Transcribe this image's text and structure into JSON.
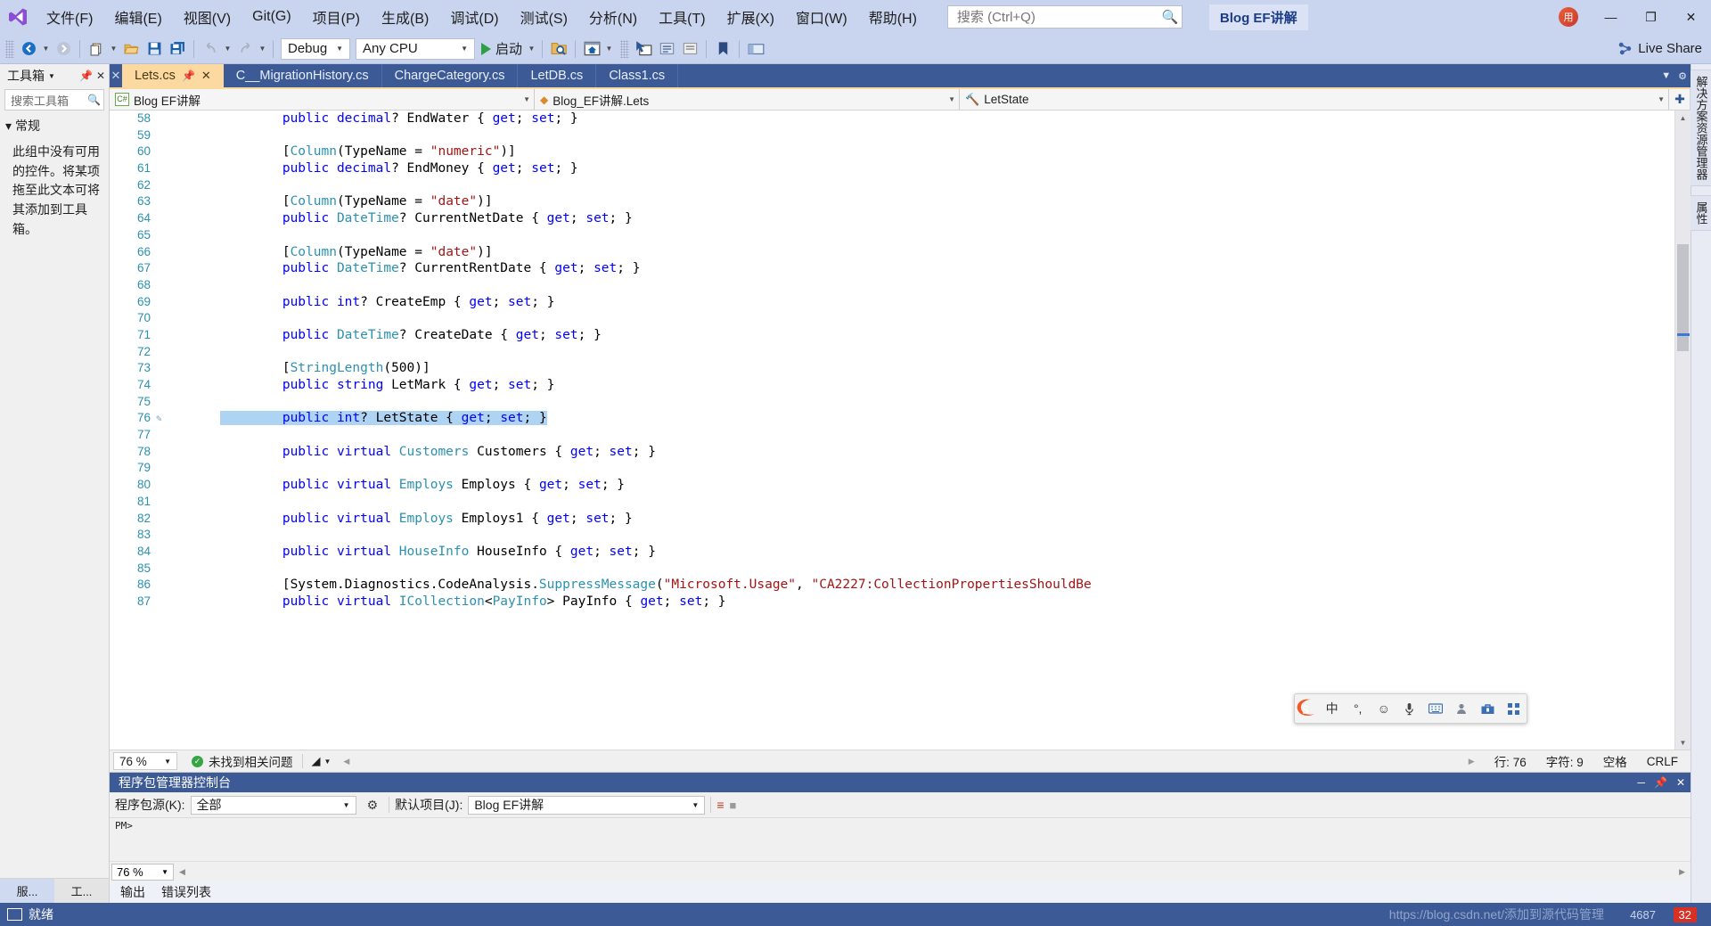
{
  "titlebar": {
    "logo_icon": "visual-studio-logo",
    "menus": [
      {
        "label": "文件(F)"
      },
      {
        "label": "编辑(E)"
      },
      {
        "label": "视图(V)"
      },
      {
        "label": "Git(G)"
      },
      {
        "label": "项目(P)"
      },
      {
        "label": "生成(B)"
      },
      {
        "label": "调试(D)"
      },
      {
        "label": "测试(S)"
      },
      {
        "label": "分析(N)"
      },
      {
        "label": "工具(T)"
      },
      {
        "label": "扩展(X)"
      },
      {
        "label": "窗口(W)"
      },
      {
        "label": "帮助(H)"
      }
    ],
    "search_placeholder": "搜索 (Ctrl+Q)",
    "search_value": "",
    "search_icon": "magnifier-icon",
    "solution_name": "Blog EF讲解",
    "avatar_initials": "用",
    "window_buttons": {
      "minimize": "—",
      "maximize": "❐",
      "close": "✕"
    }
  },
  "toolbar": {
    "nav_back_icon": "back-arrow-icon",
    "nav_forward_icon": "forward-arrow-icon",
    "new_item_icon": "new-file-icon",
    "open_icon": "open-folder-icon",
    "save_icon": "save-icon",
    "save_all_icon": "save-all-icon",
    "undo_icon": "undo-icon",
    "redo_icon": "redo-icon",
    "config_value": "Debug",
    "platform_value": "Any CPU",
    "run_label": "启动",
    "run_icon": "play-icon",
    "find_in_files_icon": "folder-search-icon",
    "home_icon": "home-window-icon",
    "select_icon": "pointer-window-icon",
    "bookmark_icon": "bookmark-icon",
    "comment_icon": "comment-icon",
    "uncomment_icon": "uncomment-icon",
    "live_share_label": "Live Share",
    "live_share_icon": "live-share-icon"
  },
  "toolbox": {
    "title": "工具箱",
    "pin_icon": "pin-icon",
    "close_icon": "close-icon",
    "search_placeholder": "搜索工具箱",
    "search_icon": "magnifier-icon",
    "group_label": "常规",
    "group_expand_icon": "triangle-down-icon",
    "empty_message": "此组中没有可用的控件。将某项拖至此文本可将其添加到工具箱。",
    "bottom_tabs": [
      {
        "label": "服...",
        "active": true
      },
      {
        "label": "工...",
        "active": false
      }
    ]
  },
  "tabstrip": {
    "left_close_icon": "close-icon",
    "tabs": [
      {
        "label": "Lets.cs",
        "active": true,
        "pin_icon": "pin-icon",
        "close_icon": "close-icon"
      },
      {
        "label": "C__MigrationHistory.cs",
        "active": false
      },
      {
        "label": "ChargeCategory.cs",
        "active": false
      },
      {
        "label": "LetDB.cs",
        "active": false
      },
      {
        "label": "Class1.cs",
        "active": false
      }
    ],
    "right_icons": [
      "chevron-down-icon",
      "gear-icon"
    ]
  },
  "navbar": {
    "project": {
      "label": "Blog EF讲解",
      "icon": "csharp-project-icon"
    },
    "type": {
      "label": "Blog_EF讲解.Lets",
      "icon": "namespace-icon"
    },
    "member": {
      "label": "LetState",
      "icon": "property-icon"
    },
    "expand_icon": "expand-icon"
  },
  "editor": {
    "first_line": 58,
    "selected_line": 76,
    "lines": [
      {
        "n": 58,
        "tokens": [
          {
            "t": "        ",
            "c": "plain"
          },
          {
            "t": "public ",
            "c": "kw"
          },
          {
            "t": "decimal",
            "c": "kw"
          },
          {
            "t": "? EndWater { ",
            "c": "plain"
          },
          {
            "t": "get",
            "c": "kw"
          },
          {
            "t": "; ",
            "c": "plain"
          },
          {
            "t": "set",
            "c": "kw"
          },
          {
            "t": "; }",
            "c": "plain"
          }
        ]
      },
      {
        "n": 59,
        "tokens": []
      },
      {
        "n": 60,
        "tokens": [
          {
            "t": "        [",
            "c": "plain"
          },
          {
            "t": "Column",
            "c": "typ"
          },
          {
            "t": "(TypeName = ",
            "c": "plain"
          },
          {
            "t": "\"numeric\"",
            "c": "str"
          },
          {
            "t": ")]",
            "c": "plain"
          }
        ]
      },
      {
        "n": 61,
        "tokens": [
          {
            "t": "        ",
            "c": "plain"
          },
          {
            "t": "public ",
            "c": "kw"
          },
          {
            "t": "decimal",
            "c": "kw"
          },
          {
            "t": "? EndMoney { ",
            "c": "plain"
          },
          {
            "t": "get",
            "c": "kw"
          },
          {
            "t": "; ",
            "c": "plain"
          },
          {
            "t": "set",
            "c": "kw"
          },
          {
            "t": "; }",
            "c": "plain"
          }
        ]
      },
      {
        "n": 62,
        "tokens": []
      },
      {
        "n": 63,
        "tokens": [
          {
            "t": "        [",
            "c": "plain"
          },
          {
            "t": "Column",
            "c": "typ"
          },
          {
            "t": "(TypeName = ",
            "c": "plain"
          },
          {
            "t": "\"date\"",
            "c": "str"
          },
          {
            "t": ")]",
            "c": "plain"
          }
        ]
      },
      {
        "n": 64,
        "tokens": [
          {
            "t": "        ",
            "c": "plain"
          },
          {
            "t": "public ",
            "c": "kw"
          },
          {
            "t": "DateTime",
            "c": "typ"
          },
          {
            "t": "? CurrentNetDate { ",
            "c": "plain"
          },
          {
            "t": "get",
            "c": "kw"
          },
          {
            "t": "; ",
            "c": "plain"
          },
          {
            "t": "set",
            "c": "kw"
          },
          {
            "t": "; }",
            "c": "plain"
          }
        ]
      },
      {
        "n": 65,
        "tokens": []
      },
      {
        "n": 66,
        "tokens": [
          {
            "t": "        [",
            "c": "plain"
          },
          {
            "t": "Column",
            "c": "typ"
          },
          {
            "t": "(TypeName = ",
            "c": "plain"
          },
          {
            "t": "\"date\"",
            "c": "str"
          },
          {
            "t": ")]",
            "c": "plain"
          }
        ]
      },
      {
        "n": 67,
        "tokens": [
          {
            "t": "        ",
            "c": "plain"
          },
          {
            "t": "public ",
            "c": "kw"
          },
          {
            "t": "DateTime",
            "c": "typ"
          },
          {
            "t": "? CurrentRentDate { ",
            "c": "plain"
          },
          {
            "t": "get",
            "c": "kw"
          },
          {
            "t": "; ",
            "c": "plain"
          },
          {
            "t": "set",
            "c": "kw"
          },
          {
            "t": "; }",
            "c": "plain"
          }
        ]
      },
      {
        "n": 68,
        "tokens": []
      },
      {
        "n": 69,
        "tokens": [
          {
            "t": "        ",
            "c": "plain"
          },
          {
            "t": "public ",
            "c": "kw"
          },
          {
            "t": "int",
            "c": "kw"
          },
          {
            "t": "? CreateEmp { ",
            "c": "plain"
          },
          {
            "t": "get",
            "c": "kw"
          },
          {
            "t": "; ",
            "c": "plain"
          },
          {
            "t": "set",
            "c": "kw"
          },
          {
            "t": "; }",
            "c": "plain"
          }
        ]
      },
      {
        "n": 70,
        "tokens": []
      },
      {
        "n": 71,
        "tokens": [
          {
            "t": "        ",
            "c": "plain"
          },
          {
            "t": "public ",
            "c": "kw"
          },
          {
            "t": "DateTime",
            "c": "typ"
          },
          {
            "t": "? CreateDate { ",
            "c": "plain"
          },
          {
            "t": "get",
            "c": "kw"
          },
          {
            "t": "; ",
            "c": "plain"
          },
          {
            "t": "set",
            "c": "kw"
          },
          {
            "t": "; }",
            "c": "plain"
          }
        ]
      },
      {
        "n": 72,
        "tokens": []
      },
      {
        "n": 73,
        "tokens": [
          {
            "t": "        [",
            "c": "plain"
          },
          {
            "t": "StringLength",
            "c": "typ"
          },
          {
            "t": "(500)]",
            "c": "plain"
          }
        ]
      },
      {
        "n": 74,
        "tokens": [
          {
            "t": "        ",
            "c": "plain"
          },
          {
            "t": "public ",
            "c": "kw"
          },
          {
            "t": "string",
            "c": "kw"
          },
          {
            "t": " LetMark { ",
            "c": "plain"
          },
          {
            "t": "get",
            "c": "kw"
          },
          {
            "t": "; ",
            "c": "plain"
          },
          {
            "t": "set",
            "c": "kw"
          },
          {
            "t": "; }",
            "c": "plain"
          }
        ]
      },
      {
        "n": 75,
        "tokens": []
      },
      {
        "n": 76,
        "selected": true,
        "glyph": "pencil-icon",
        "tokens": [
          {
            "t": "        ",
            "c": "plain"
          },
          {
            "t": "public ",
            "c": "kw"
          },
          {
            "t": "int",
            "c": "kw"
          },
          {
            "t": "? LetState { ",
            "c": "plain"
          },
          {
            "t": "get",
            "c": "kw"
          },
          {
            "t": "; ",
            "c": "plain"
          },
          {
            "t": "set",
            "c": "kw"
          },
          {
            "t": "; }",
            "c": "plain"
          }
        ]
      },
      {
        "n": 77,
        "tokens": []
      },
      {
        "n": 78,
        "tokens": [
          {
            "t": "        ",
            "c": "plain"
          },
          {
            "t": "public ",
            "c": "kw"
          },
          {
            "t": "virtual ",
            "c": "kw"
          },
          {
            "t": "Customers",
            "c": "typ"
          },
          {
            "t": " Customers { ",
            "c": "plain"
          },
          {
            "t": "get",
            "c": "kw"
          },
          {
            "t": "; ",
            "c": "plain"
          },
          {
            "t": "set",
            "c": "kw"
          },
          {
            "t": "; }",
            "c": "plain"
          }
        ]
      },
      {
        "n": 79,
        "tokens": []
      },
      {
        "n": 80,
        "tokens": [
          {
            "t": "        ",
            "c": "plain"
          },
          {
            "t": "public ",
            "c": "kw"
          },
          {
            "t": "virtual ",
            "c": "kw"
          },
          {
            "t": "Employs",
            "c": "typ"
          },
          {
            "t": " Employs { ",
            "c": "plain"
          },
          {
            "t": "get",
            "c": "kw"
          },
          {
            "t": "; ",
            "c": "plain"
          },
          {
            "t": "set",
            "c": "kw"
          },
          {
            "t": "; }",
            "c": "plain"
          }
        ]
      },
      {
        "n": 81,
        "tokens": []
      },
      {
        "n": 82,
        "tokens": [
          {
            "t": "        ",
            "c": "plain"
          },
          {
            "t": "public ",
            "c": "kw"
          },
          {
            "t": "virtual ",
            "c": "kw"
          },
          {
            "t": "Employs",
            "c": "typ"
          },
          {
            "t": " Employs1 { ",
            "c": "plain"
          },
          {
            "t": "get",
            "c": "kw"
          },
          {
            "t": "; ",
            "c": "plain"
          },
          {
            "t": "set",
            "c": "kw"
          },
          {
            "t": "; }",
            "c": "plain"
          }
        ]
      },
      {
        "n": 83,
        "tokens": []
      },
      {
        "n": 84,
        "tokens": [
          {
            "t": "        ",
            "c": "plain"
          },
          {
            "t": "public ",
            "c": "kw"
          },
          {
            "t": "virtual ",
            "c": "kw"
          },
          {
            "t": "HouseInfo",
            "c": "typ"
          },
          {
            "t": " HouseInfo { ",
            "c": "plain"
          },
          {
            "t": "get",
            "c": "kw"
          },
          {
            "t": "; ",
            "c": "plain"
          },
          {
            "t": "set",
            "c": "kw"
          },
          {
            "t": "; }",
            "c": "plain"
          }
        ]
      },
      {
        "n": 85,
        "tokens": []
      },
      {
        "n": 86,
        "tokens": [
          {
            "t": "        [System.Diagnostics.CodeAnalysis.",
            "c": "plain"
          },
          {
            "t": "SuppressMessage",
            "c": "typ"
          },
          {
            "t": "(",
            "c": "plain"
          },
          {
            "t": "\"Microsoft.Usage\"",
            "c": "str"
          },
          {
            "t": ", ",
            "c": "plain"
          },
          {
            "t": "\"CA2227:CollectionPropertiesShouldBe",
            "c": "str"
          }
        ]
      },
      {
        "n": 87,
        "tokens": [
          {
            "t": "        ",
            "c": "plain"
          },
          {
            "t": "public ",
            "c": "kw"
          },
          {
            "t": "virtual ",
            "c": "kw"
          },
          {
            "t": "ICollection",
            "c": "typ"
          },
          {
            "t": "<",
            "c": "plain"
          },
          {
            "t": "PayInfo",
            "c": "typ"
          },
          {
            "t": "> PayInfo { ",
            "c": "plain"
          },
          {
            "t": "get",
            "c": "kw"
          },
          {
            "t": "; ",
            "c": "plain"
          },
          {
            "t": "set",
            "c": "kw"
          },
          {
            "t": "; }",
            "c": "plain"
          }
        ]
      }
    ]
  },
  "right_dock": {
    "tabs": [
      {
        "label": "解决方案资源管理器"
      },
      {
        "label": "属性"
      }
    ]
  },
  "ime": {
    "logo_icon": "sogou-logo-icon",
    "items": [
      {
        "icon": "chinese-mode-icon",
        "label": "中"
      },
      {
        "icon": "punctuation-icon",
        "label": "°,"
      },
      {
        "icon": "emoji-icon",
        "label": "☺"
      },
      {
        "icon": "microphone-icon",
        "label": "🎤"
      },
      {
        "icon": "keyboard-icon",
        "label": "⌨"
      },
      {
        "icon": "person-icon",
        "label": "👤"
      },
      {
        "icon": "toolbox-icon",
        "label": "🧰"
      },
      {
        "icon": "grid-menu-icon",
        "label": "▦"
      }
    ]
  },
  "editor_status": {
    "zoom": "76 %",
    "issues_text": "未找到相关问题",
    "issues_icon": "check-circle-icon",
    "filter_icon": "funnel-icon",
    "prev_icon": "chevron-left-icon",
    "next_icon": "chevron-right-icon",
    "line_label": "行: 76",
    "col_label": "字符: 9",
    "spaces_label": "空格",
    "eol_label": "CRLF"
  },
  "pmc": {
    "title": "程序包管理器控制台",
    "minimize_icon": "minimize-icon",
    "pin_icon": "pin-icon",
    "close_icon": "close-icon",
    "source_label": "程序包源(K):",
    "source_value": "全部",
    "gear_icon": "gear-icon",
    "project_label": "默认项目(J):",
    "project_value": "Blog EF讲解",
    "clear_icon": "clear-console-icon",
    "stop_icon": "stop-icon",
    "prompt": "PM>",
    "zoom": "76 %"
  },
  "output_tabs": [
    {
      "label": "输出"
    },
    {
      "label": "错误列表"
    }
  ],
  "statusbar": {
    "icon": "window-icon",
    "ready_label": "就绪",
    "watermark": "https://blog.csdn.net/添加到源代码管理",
    "watermark_num": "4687",
    "badge": "32"
  }
}
